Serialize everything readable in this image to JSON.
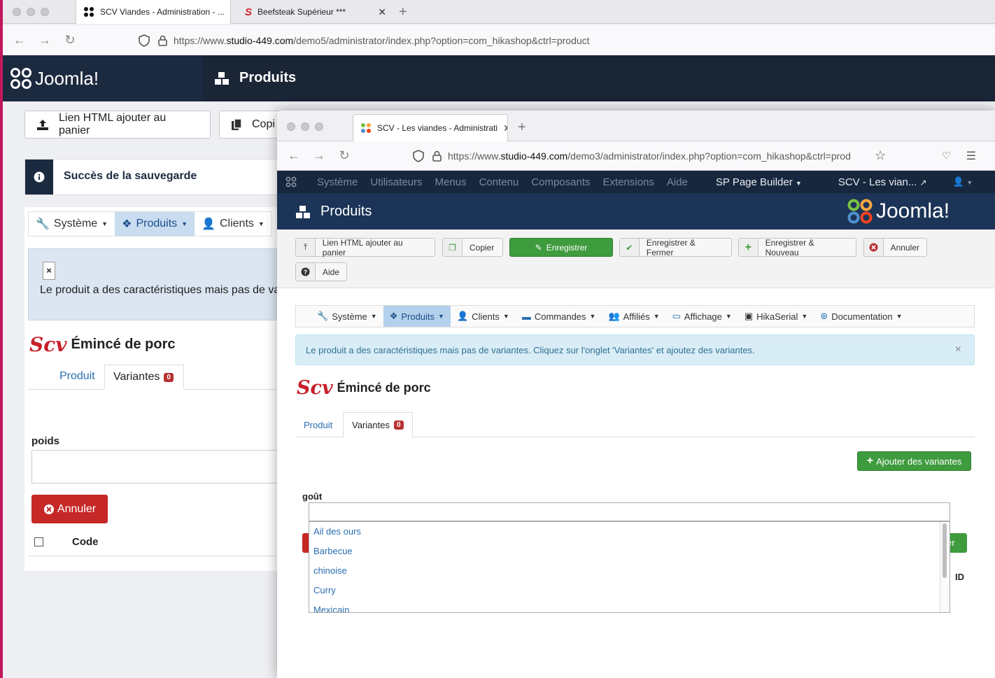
{
  "back": {
    "tabs": [
      {
        "label": "SCV Viandes - Administration - ..."
      },
      {
        "label": "Beefsteak Supérieur ***"
      }
    ],
    "url_prefix": "https://www.",
    "url_host": "studio-449.com",
    "url_path": "/demo5/administrator/index.php?option=com_hikashop&ctrl=product",
    "logo_text": "Joomla!",
    "header_title": "Produits",
    "btn_html": "Lien HTML ajouter au panier",
    "btn_copy": "Copi",
    "success_msg": "Succès de la sauvegarde",
    "nav": [
      {
        "label": "Système"
      },
      {
        "label": "Produits"
      },
      {
        "label": "Clients"
      }
    ],
    "close_x": "×",
    "info_msg": "Le produit a des caractéristiques mais pas de va",
    "product_title": "Émincé de porc",
    "scv_logo": "Scv",
    "tab_product": "Produit",
    "tab_variants": "Variantes",
    "variants_count": "0",
    "field_label": "poids",
    "btn_cancel": "Annuler",
    "col_code": "Code"
  },
  "front": {
    "tab_label": "SCV - Les viandes - Administrati",
    "url_prefix": "https://www.",
    "url_host": "studio-449.com",
    "url_path": "/demo3/administrator/index.php?option=com_hikashop&ctrl=prod",
    "topnav": [
      "Système",
      "Utilisateurs",
      "Menus",
      "Contenu",
      "Composants",
      "Extensions",
      "Aide"
    ],
    "sp_builder": "SP Page Builder",
    "site_link": "SCV - Les vian...",
    "title": "Produits",
    "logo_text": "Joomla!",
    "toolbar": {
      "html_link": "Lien HTML ajouter au panier",
      "copy": "Copier",
      "save": "Enregistrer",
      "save_close": "Enregistrer & Fermer",
      "save_new": "Enregistrer & Nouveau",
      "cancel": "Annuler",
      "help": "Aide"
    },
    "menu": [
      "Système",
      "Produits",
      "Clients",
      "Commandes",
      "Affiliés",
      "Affichage",
      "HikaSerial",
      "Documentation"
    ],
    "alert": "Le produit a des caractéristiques mais pas de variantes. Cliquez sur l'onglet 'Variantes' et ajoutez des variantes.",
    "alert_close": "×",
    "scv_logo": "Scv",
    "product_title": "Émincé de porc",
    "tab_product": "Produit",
    "tab_variants": "Variantes",
    "variants_count": "0",
    "add_variants": "Ajouter des variantes",
    "field_label": "goût",
    "options": [
      "Ail des ours",
      "Barbecue",
      "chinoise",
      "Curry",
      "Mexicain"
    ],
    "hidden_btn_tail": "er",
    "col_id": "ID"
  },
  "colors": {
    "joomla_dark": "#1c2a40",
    "title_bar": "#1b3457",
    "green": "#3e9b3e",
    "danger": "#b83232",
    "link": "#2a6fb0"
  }
}
